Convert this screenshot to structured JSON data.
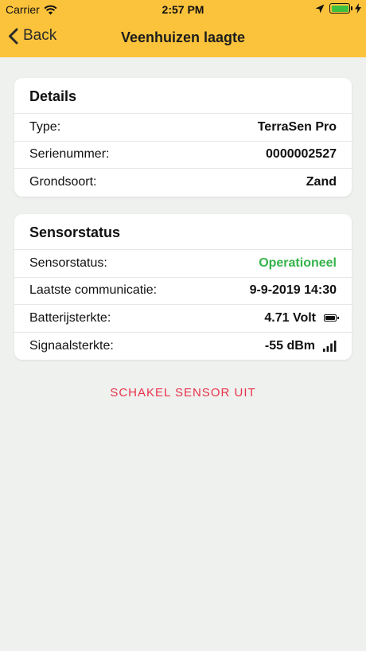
{
  "status_bar": {
    "carrier": "Carrier",
    "time": "2:57 PM"
  },
  "nav": {
    "back_label": "Back",
    "title": "Veenhuizen laagte"
  },
  "details": {
    "title": "Details",
    "rows": [
      {
        "label": "Type:",
        "value": "TerraSen Pro"
      },
      {
        "label": "Serienummer:",
        "value": "0000002527"
      },
      {
        "label": "Grondsoort:",
        "value": "Zand"
      }
    ]
  },
  "sensor": {
    "title": "Sensorstatus",
    "rows": [
      {
        "label": "Sensorstatus:",
        "value": "Operationeel"
      },
      {
        "label": "Laatste communicatie:",
        "value": "9-9-2019 14:30"
      },
      {
        "label": "Batterijsterkte:",
        "value": "4.71 Volt"
      },
      {
        "label": "Signaalsterkte:",
        "value": "-55 dBm"
      }
    ]
  },
  "action": {
    "label": "SCHAKEL SENSOR UIT"
  },
  "colors": {
    "header": "#fbc33c",
    "background": "#eff1ef",
    "operational": "#35b34a",
    "action": "#e8334a"
  },
  "icons": {
    "wifi": "wifi-icon",
    "location": "location-arrow-icon",
    "charging": "bolt-icon",
    "battery": "battery-icon",
    "signal": "signal-bars-icon",
    "back": "chevron-left-icon"
  }
}
